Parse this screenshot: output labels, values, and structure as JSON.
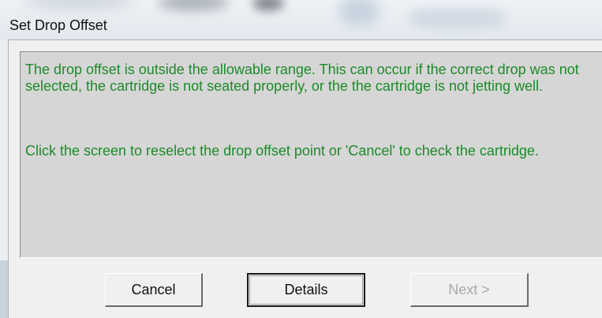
{
  "window": {
    "title": "Set Drop Offset"
  },
  "message": {
    "paragraph1": "The drop offset is outside the allowable range. This can occur if the correct drop was not selected, the cartridge is not seated properly, or the the cartridge is not jetting well.",
    "paragraph2": "Click the screen to reselect the drop offset point or 'Cancel' to check the cartridge.",
    "text_color": "#1d8a2a"
  },
  "buttons": {
    "cancel_label": "Cancel",
    "details_label": "Details",
    "next_label": "Next >",
    "next_enabled": false
  }
}
